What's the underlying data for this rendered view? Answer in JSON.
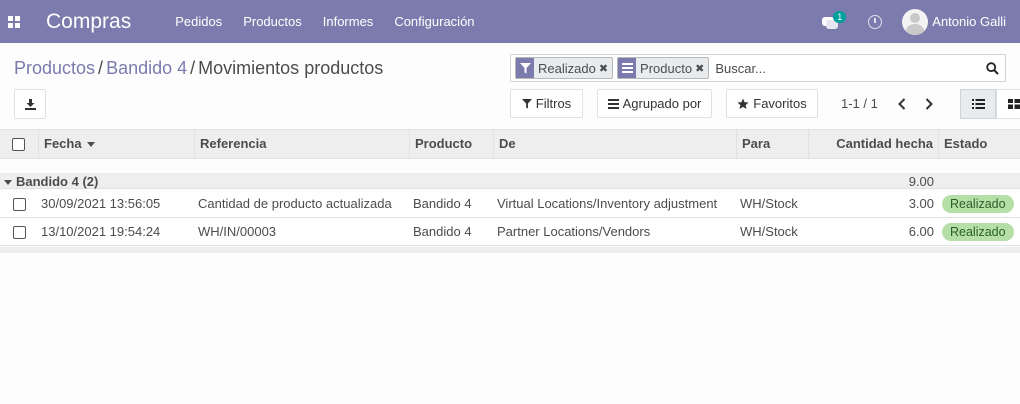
{
  "navbar": {
    "app_title": "Compras",
    "menu": [
      {
        "label": "Pedidos"
      },
      {
        "label": "Productos"
      },
      {
        "label": "Informes"
      },
      {
        "label": "Configuración"
      }
    ],
    "chat_count": "1",
    "user_name": "Antonio Galli",
    "icons": {
      "apps": "apps-grid-icon",
      "chat": "chat-icon",
      "activity": "clock-icon"
    },
    "color": "#7c7bad"
  },
  "breadcrumb": {
    "items": [
      "Productos",
      "Bandido 4"
    ],
    "current": "Movimientos productos",
    "separator": "/"
  },
  "search": {
    "facets": [
      {
        "icon": "filter-icon",
        "value": "Realizado"
      },
      {
        "icon": "group-by-icon",
        "value": "Producto"
      }
    ],
    "placeholder": "Buscar...",
    "search_icon": "magnifier-icon"
  },
  "toolbar": {
    "filters_label": "Filtros",
    "group_by_label": "Agrupado por",
    "favorites_label": "Favoritos",
    "pager": "1-1 / 1",
    "views": [
      "list-view-icon",
      "kanban-view-icon"
    ]
  },
  "table": {
    "columns": [
      "Fecha",
      "Referencia",
      "Producto",
      "De",
      "Para",
      "Cantidad hecha",
      "Estado"
    ],
    "group": {
      "label": "Bandido 4 (2)",
      "total": "9.00"
    },
    "rows": [
      {
        "fecha": "30/09/2021 13:56:05",
        "referencia": "Cantidad de producto actualizada",
        "producto": "Bandido 4",
        "de": "Virtual Locations/Inventory adjustment",
        "para": "WH/Stock",
        "cantidad": "3.00",
        "estado": "Realizado"
      },
      {
        "fecha": "13/10/2021 19:54:24",
        "referencia": "WH/IN/00003",
        "producto": "Bandido 4",
        "de": "Partner Locations/Vendors",
        "para": "WH/Stock",
        "cantidad": "6.00",
        "estado": "Realizado"
      }
    ],
    "status_color": "#b5dfa6"
  }
}
